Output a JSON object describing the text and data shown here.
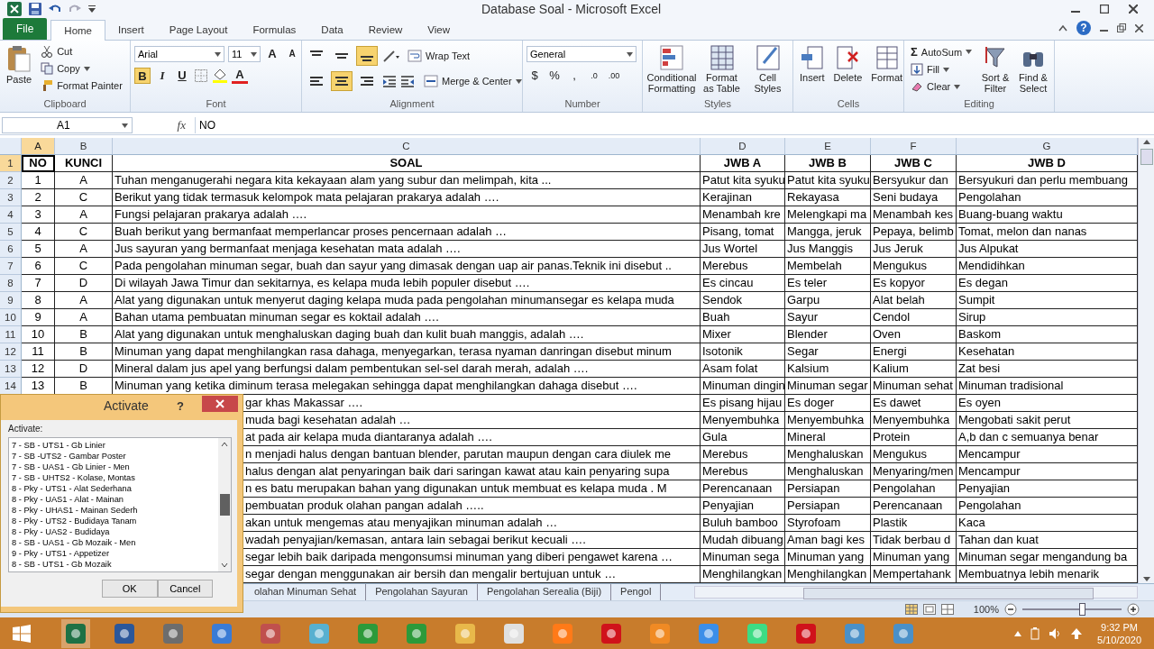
{
  "window": {
    "title": "Database Soal - Microsoft Excel"
  },
  "ribbon_tabs": [
    {
      "label": "File",
      "kind": "file",
      "selected": false
    },
    {
      "label": "Home",
      "kind": "tab",
      "selected": true
    },
    {
      "label": "Insert",
      "kind": "tab",
      "selected": false
    },
    {
      "label": "Page Layout",
      "kind": "tab",
      "selected": false
    },
    {
      "label": "Formulas",
      "kind": "tab",
      "selected": false
    },
    {
      "label": "Data",
      "kind": "tab",
      "selected": false
    },
    {
      "label": "Review",
      "kind": "tab",
      "selected": false
    },
    {
      "label": "View",
      "kind": "tab",
      "selected": false
    }
  ],
  "help": "?",
  "clipboard": {
    "label": "Clipboard",
    "paste": "Paste",
    "cut": "Cut",
    "copy": "Copy",
    "format_painter": "Format Painter"
  },
  "font": {
    "label": "Font",
    "name": "Arial",
    "size": "11",
    "grow": "A",
    "shrink": "A",
    "bold": "B",
    "bold_on": true,
    "italic": "I",
    "underline": "U",
    "color_letter": "A"
  },
  "alignment": {
    "label": "Alignment",
    "wrap_text": "Wrap Text",
    "merge_center": "Merge & Center",
    "vertical": [
      {
        "selected": false
      },
      {
        "selected": false
      },
      {
        "selected": true
      }
    ],
    "horizontal": [
      {
        "selected": false
      },
      {
        "selected": true
      },
      {
        "selected": false
      }
    ]
  },
  "number": {
    "label": "Number",
    "format": "General",
    "currency": "$",
    "percent": "%",
    "comma": ",",
    "increase_decimal": ".0",
    "decrease_decimal": ".00"
  },
  "styles": {
    "label": "Styles",
    "conditional": "Conditional Formatting",
    "table": "Format as Table",
    "cell_styles": "Cell Styles"
  },
  "cells": {
    "label": "Cells",
    "insert": "Insert",
    "delete": "Delete",
    "format": "Format"
  },
  "editing": {
    "label": "Editing",
    "sum_symbol": "Σ",
    "autosum": "AutoSum",
    "fill": "Fill",
    "clear": "Clear",
    "sort": "Sort & Filter",
    "find": "Find & Select"
  },
  "formula_bar": {
    "name_box": "A1",
    "fx": "fx",
    "value": "NO"
  },
  "columns": [
    {
      "label": "A",
      "selected": true
    },
    {
      "label": "B",
      "selected": false
    },
    {
      "label": "C",
      "selected": false
    },
    {
      "label": "D",
      "selected": false
    },
    {
      "label": "E",
      "selected": false
    },
    {
      "label": "F",
      "selected": false
    },
    {
      "label": "G",
      "selected": false
    }
  ],
  "rows": [
    {
      "num": "1",
      "kind": "header",
      "selected": true,
      "cells": [
        "NO",
        "KUNCI",
        "SOAL",
        "JWB A",
        "JWB B",
        "JWB C",
        "JWB D"
      ]
    },
    {
      "num": "2",
      "kind": "data",
      "selected": false,
      "cells": [
        "1",
        "A",
        "Tuhan menganugerahi negara kita kekayaan alam yang subur dan melimpah, kita ...",
        "Patut kita syuku",
        "Patut kita syuku",
        "Bersyukur dan",
        "Bersyukuri dan perlu membuang"
      ]
    },
    {
      "num": "3",
      "kind": "data",
      "selected": false,
      "cells": [
        "2",
        "C",
        "Berikut yang tidak termasuk kelompok mata pelajaran prakarya adalah ….",
        "Kerajinan",
        "Rekayasa",
        "Seni budaya",
        "Pengolahan"
      ]
    },
    {
      "num": "4",
      "kind": "data",
      "selected": false,
      "cells": [
        "3",
        "A",
        "Fungsi pelajaran prakarya adalah ….",
        "Menambah kre",
        "Melengkapi ma",
        "Menambah kes",
        "Buang-buang waktu"
      ]
    },
    {
      "num": "5",
      "kind": "data",
      "selected": false,
      "cells": [
        "4",
        "C",
        "Buah berikut yang bermanfaat memperlancar proses pencernaan adalah …",
        "Pisang, tomat",
        "Mangga, jeruk",
        "Pepaya, belimb",
        "Tomat, melon dan nanas"
      ]
    },
    {
      "num": "6",
      "kind": "data",
      "selected": false,
      "cells": [
        "5",
        "A",
        "Jus sayuran yang bermanfaat menjaga kesehatan mata adalah ….",
        "Jus Wortel",
        "Jus Manggis",
        "Jus Jeruk",
        "Jus Alpukat"
      ]
    },
    {
      "num": "7",
      "kind": "data",
      "selected": false,
      "cells": [
        "6",
        "C",
        "Pada pengolahan minuman segar, buah dan sayur yang dimasak dengan uap air panas.Teknik ini disebut ..",
        "Merebus",
        "Membelah",
        "Mengukus",
        "Mendidihkan"
      ]
    },
    {
      "num": "8",
      "kind": "data",
      "selected": false,
      "cells": [
        "7",
        "D",
        "Di wilayah Jawa Timur dan sekitarnya, es kelapa muda lebih populer disebut ….",
        "Es cincau",
        "Es teler",
        "Es kopyor",
        "Es degan"
      ]
    },
    {
      "num": "9",
      "kind": "data",
      "selected": false,
      "cells": [
        "8",
        "A",
        "Alat yang digunakan untuk menyerut daging kelapa muda pada pengolahan minumansegar es kelapa muda",
        "Sendok",
        "Garpu",
        "Alat belah",
        "Sumpit"
      ]
    },
    {
      "num": "10",
      "kind": "data",
      "selected": false,
      "cells": [
        "9",
        "A",
        "Bahan utama pembuatan minuman segar es koktail adalah ….",
        "Buah",
        "Sayur",
        "Cendol",
        "Sirup"
      ]
    },
    {
      "num": "11",
      "kind": "data",
      "selected": false,
      "cells": [
        "10",
        "B",
        "Alat yang digunakan untuk menghaluskan daging buah dan kulit buah manggis, adalah ….",
        "Mixer",
        "Blender",
        "Oven",
        "Baskom"
      ]
    },
    {
      "num": "12",
      "kind": "data",
      "selected": false,
      "cells": [
        "11",
        "B",
        "Minuman yang dapat menghilangkan rasa dahaga, menyegarkan, terasa nyaman danringan disebut minum",
        "Isotonik",
        "Segar",
        "Energi",
        "Kesehatan"
      ]
    },
    {
      "num": "13",
      "kind": "data",
      "selected": false,
      "cells": [
        "12",
        "D",
        "Mineral dalam jus apel yang berfungsi dalam pembentukan sel-sel darah merah, adalah ….",
        "Asam folat",
        "Kalsium",
        "Kalium",
        "Zat besi"
      ]
    },
    {
      "num": "14",
      "kind": "data",
      "selected": false,
      "cells": [
        "13",
        "B",
        "Minuman yang ketika diminum terasa melegakan sehingga dapat menghilangkan dahaga disebut ….",
        "Minuman dingin",
        "Minuman segar",
        "Minuman sehat",
        "Minuman tradisional"
      ]
    }
  ],
  "rows_under_dialog": [
    [
      "gar khas Makassar ….",
      "Es pisang hijau",
      "Es doger",
      "Es dawet",
      "Es oyen"
    ],
    [
      "muda bagi kesehatan adalah …",
      "Menyembuhka",
      "Menyembuhka",
      "Menyembuhka",
      "Mengobati sakit perut"
    ],
    [
      "at pada air kelapa muda diantaranya adalah ….",
      "Gula",
      "Mineral",
      "Protein",
      "A,b dan c semuanya benar"
    ],
    [
      "n menjadi halus dengan bantuan blender, parutan maupun dengan cara diulek me",
      "Merebus",
      "Menghaluskan",
      "Mengukus",
      "Mencampur"
    ],
    [
      "halus dengan alat penyaringan baik dari saringan kawat atau kain penyaring supa",
      "Merebus",
      "Menghaluskan",
      "Menyaring/men",
      "Mencampur"
    ],
    [
      "n es batu merupakan bahan yang digunakan untuk membuat es kelapa muda . M",
      "Perencanaan",
      "Persiapan",
      "Pengolahan",
      "Penyajian"
    ],
    [
      "pembuatan produk olahan pangan adalah …..",
      "Penyajian",
      "Persiapan",
      "Perencanaan",
      "Pengolahan"
    ],
    [
      "akan untuk mengemas atau menyajikan minuman adalah …",
      "Buluh bamboo",
      "Styrofoam",
      "Plastik",
      "Kaca"
    ],
    [
      "wadah penyajian/kemasan, antara lain sebagai berikut kecuali ….",
      "Mudah dibuang",
      "Aman bagi kes",
      "Tidak berbau d",
      "Tahan dan kuat"
    ],
    [
      "segar lebih baik daripada mengonsumsi minuman yang diberi pengawet karena …",
      "Minuman sega",
      "Minuman yang",
      "Minuman yang",
      "Minuman segar mengandung ba"
    ],
    [
      "segar dengan menggunakan air bersih dan mengalir bertujuan untuk …",
      "Menghilangkan",
      "Menghilangkan",
      "Mempertahank",
      "Membuatnya lebih menarik"
    ]
  ],
  "sheet_tabs": [
    "olahan Minuman Sehat",
    "Pengolahan Sayuran",
    "Pengolahan Serealia (Biji)",
    "Pengol"
  ],
  "status_bar": {
    "zoom": "100%",
    "zoom_slider": {
      "level": 0.6
    }
  },
  "dialog": {
    "title": "Activate",
    "help": "?",
    "list_label": "Activate:",
    "items": [
      "7 - SB - UTS1 - Gb Linier",
      "7 - SB -UTS2 - Gambar Poster",
      "7 - SB - UAS1 - Gb Linier - Men",
      "7 - SB - UHTS2 - Kolase, Montas",
      "8 - Pky - UTS1 - Alat Sederhana",
      "8 - Pky - UAS1 - Alat - Mainan",
      "8 - Pky - UHAS1 - Mainan Sederh",
      "8 - Pky - UTS2 - Budidaya Tanam",
      "8 - Pky - UAS2 - Budidaya",
      "8 - SB - UAS1 - Gb Mozaik - Men",
      "9 - Pky - UTS1 - Appetizer",
      "8 - SB - UTS1 - Gb Mozaik"
    ],
    "buttons": [
      "OK",
      "Cancel"
    ]
  },
  "taskbar": {
    "time": "9:32 PM",
    "date": "5/10/2020"
  }
}
